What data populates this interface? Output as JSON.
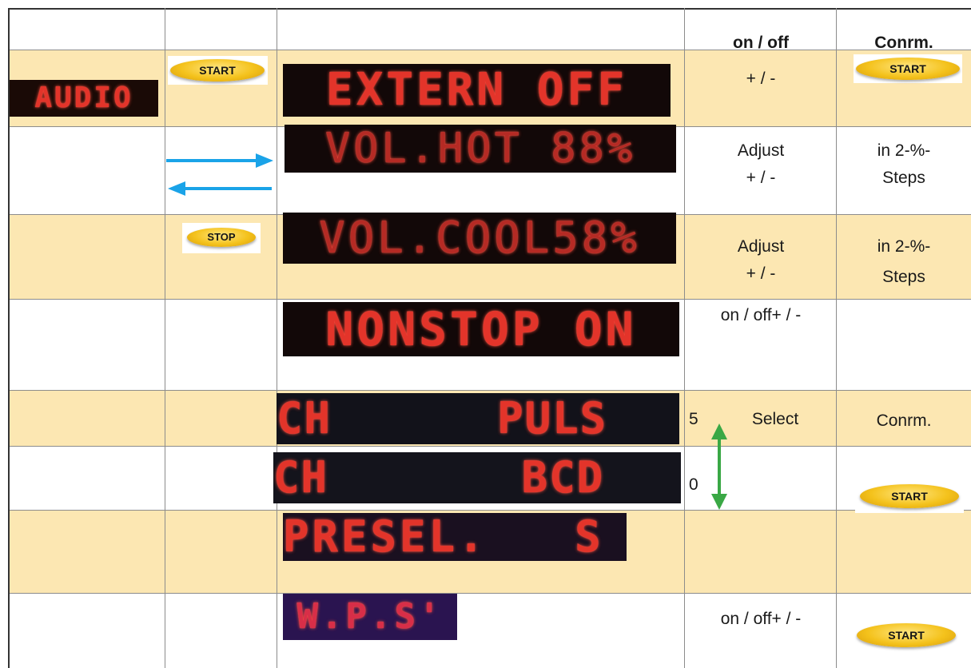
{
  "header": {
    "col4": "on / off",
    "col5": "Conrm."
  },
  "audio_label": "AUDIO",
  "buttons": {
    "start": "START",
    "stop": "STOP"
  },
  "rows": [
    {
      "display": "EXTERN OFF",
      "col4": "+ / -"
    },
    {
      "display": "VOL.HOT 88%",
      "col4_line1": "Adjust",
      "col4_line2": "+ / -",
      "col5_line1": "in 2-%-",
      "col5_line2": "Steps"
    },
    {
      "display": "VOL.COOL58%",
      "col4_line1": "Adjust",
      "col4_line2": "+ / -",
      "col5_line1": "in 2-%-",
      "col5_line2": "Steps"
    },
    {
      "display": "NONSTOP ON",
      "col4": "on / off+ / -"
    },
    {
      "display": "CH      PULS",
      "col4_num": "5",
      "col4_text": "Select",
      "col5": "Conrm."
    },
    {
      "display": "CH       BCD",
      "col4_num": "0"
    },
    {
      "display": "PRESEL.   S"
    },
    {
      "display": "W.P.S'",
      "col4": "on / off+ / -"
    }
  ],
  "colors": {
    "row_tan": "#fce7b2",
    "arrow_blue": "#1aa3e8",
    "arrow_green": "#3aa845",
    "led_red": "#e3342a"
  }
}
